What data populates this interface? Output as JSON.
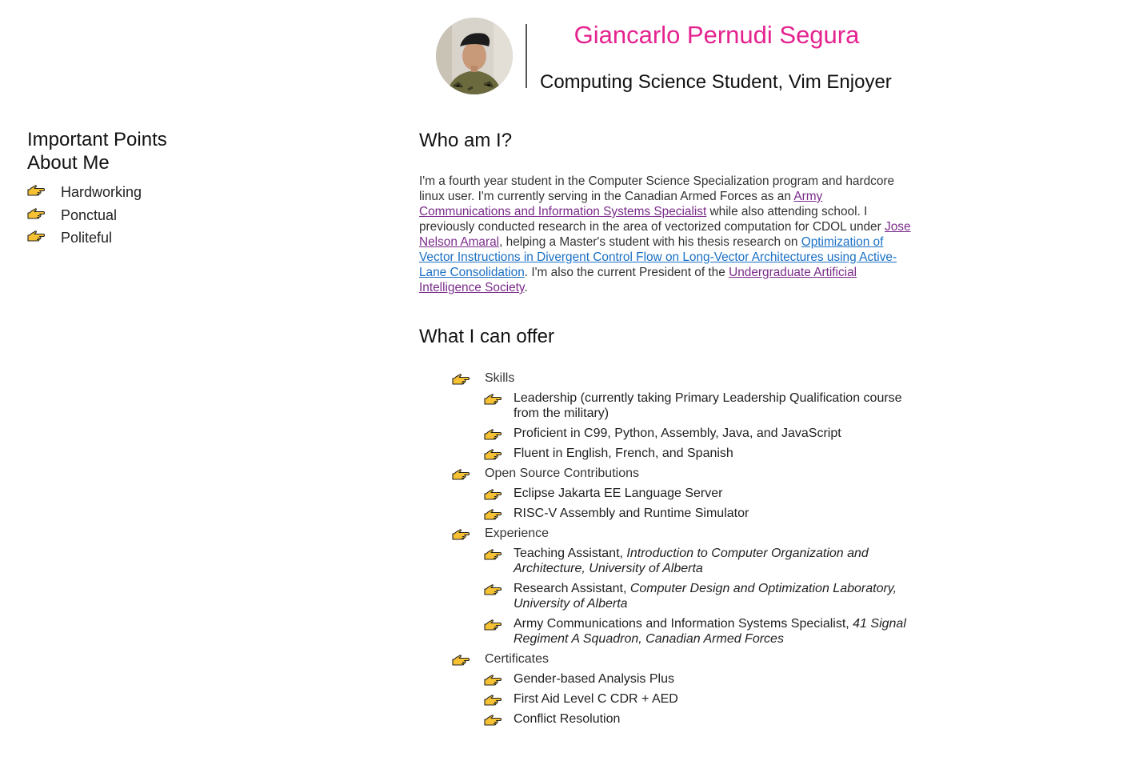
{
  "header": {
    "name": "Giancarlo Pernudi Segura",
    "subtitle": "Computing Science Student, Vim Enjoyer"
  },
  "sidebar": {
    "title_line1": "Important Points",
    "title_line2": "About Me",
    "items": [
      "Hardworking",
      "Ponctual",
      "Politeful"
    ]
  },
  "who": {
    "title": "Who am I?",
    "p1": "I'm a fourth year student in the Computer Science Specialization program and hardcore linux user. I'm currently serving in the Canadian Armed Forces as an ",
    "link_army": "Army Communications and Information Systems Specialist",
    "p2": " while also attending school. I previously conducted research in the area of vectorized computation for CDOL under ",
    "link_jose": "Jose Nelson Amaral",
    "p3": ", helping a Master's student with his thesis research on ",
    "link_thesis": "Optimization of Vector Instructions in Divergent Control Flow on Long-Vector Architectures using Active-Lane Consolidation",
    "p4": ". I'm also the current President of the ",
    "link_uais": "Undergraduate Artificial Intelligence Society",
    "p5": "."
  },
  "offer": {
    "title": "What I can offer",
    "skills": {
      "label": "Skills",
      "items": [
        "Leadership (currently taking Primary Leadership Qualification course from the military)",
        "Proficient in C99, Python, Assembly, Java, and JavaScript",
        "Fluent in English, French, and Spanish"
      ]
    },
    "oss": {
      "label": "Open Source Contributions",
      "items": [
        "Eclipse Jakarta EE Language Server",
        "RISC-V Assembly and Runtime Simulator"
      ]
    },
    "experience": {
      "label": "Experience",
      "items": [
        {
          "role": "Teaching Assistant, ",
          "place": "Introduction to Computer Organization and Architecture, University of Alberta"
        },
        {
          "role": "Research Assistant, ",
          "place": "Computer Design and Optimization Laboratory, University of Alberta"
        },
        {
          "role": "Army Communications and Information Systems Specialist, ",
          "place": "41 Signal Regiment A Squadron, Canadian Armed Forces"
        }
      ]
    },
    "certificates": {
      "label": "Certificates",
      "items": [
        "Gender-based Analysis Plus",
        "First Aid Level C CDR + AED",
        "Conflict Resolution"
      ]
    }
  },
  "colors": {
    "name": "#e5238f",
    "link_visited": "#7a2b8a",
    "link": "#1a6fc4",
    "hand_fill": "#f6c233"
  },
  "icons": {
    "bullet": "pointing-hand-icon"
  }
}
